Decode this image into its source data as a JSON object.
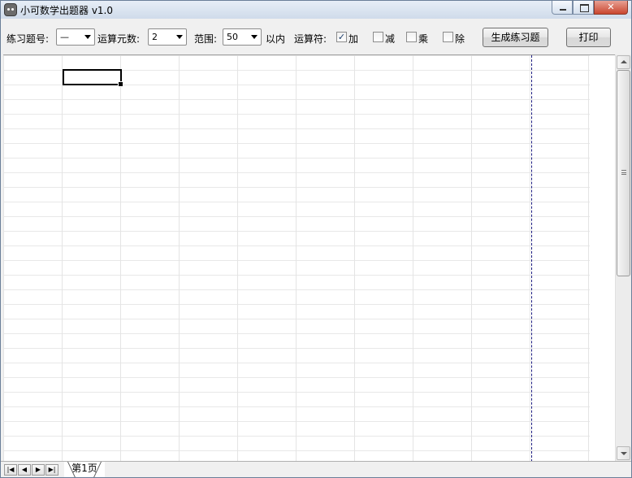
{
  "window": {
    "title": "小可数学出题器 v1.0",
    "icon": "app-cat-icon"
  },
  "toolbar": {
    "exercise_no_label": "练习题号:",
    "exercise_no_value": "—",
    "operands_label": "运算元数:",
    "operands_value": "2",
    "range_label": "范围:",
    "range_value": "50",
    "range_suffix": "以内",
    "operators_label": "运算符:",
    "operators": [
      {
        "label": "加",
        "checked": true
      },
      {
        "label": "减",
        "checked": false
      },
      {
        "label": "乘",
        "checked": false
      },
      {
        "label": "除",
        "checked": false
      }
    ],
    "generate_button": "生成练习题",
    "print_button": "打印"
  },
  "sheet": {
    "tab_label": "第1页",
    "nav": [
      "first",
      "prev",
      "next",
      "last"
    ]
  },
  "colors": {
    "page_break": "#1a1a80",
    "grid_line": "#e4e4e4"
  }
}
